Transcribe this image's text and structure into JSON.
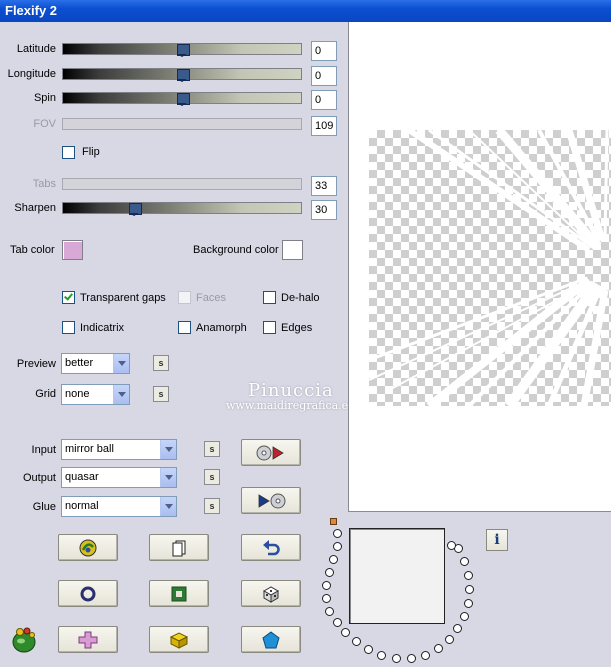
{
  "window": {
    "title": "Flexify 2"
  },
  "sliders": {
    "latitude": {
      "label": "Latitude",
      "value": "0",
      "level": 0.5
    },
    "longitude": {
      "label": "Longitude",
      "value": "0",
      "level": 0.5
    },
    "spin": {
      "label": "Spin",
      "value": "0",
      "level": 0.5
    },
    "fov": {
      "label": "FOV",
      "value": "109",
      "disabled": true
    },
    "tabs": {
      "label": "Tabs",
      "value": "33",
      "disabled": true
    },
    "sharpen": {
      "label": "Sharpen",
      "value": "30",
      "level": 0.3
    }
  },
  "flip": {
    "label": "Flip",
    "checked": false
  },
  "colors": {
    "tab_color_label": "Tab color",
    "tab_color": "#d8a9d6",
    "background_color_label": "Background color",
    "background_color": "#ffffff"
  },
  "options": {
    "transparent_gaps": {
      "label": "Transparent gaps",
      "checked": true
    },
    "faces": {
      "label": "Faces",
      "checked": false,
      "disabled": true
    },
    "de_halo": {
      "label": "De-halo",
      "checked": false
    },
    "indicatrix": {
      "label": "Indicatrix",
      "checked": false
    },
    "anamorph": {
      "label": "Anamorph",
      "checked": false
    },
    "edges": {
      "label": "Edges",
      "checked": false
    }
  },
  "preview": {
    "label": "Preview",
    "value": "better"
  },
  "grid": {
    "label": "Grid",
    "value": "none"
  },
  "input": {
    "label": "Input",
    "value": "mirror ball"
  },
  "output": {
    "label": "Output",
    "value": "quasar"
  },
  "glue": {
    "label": "Glue",
    "value": "normal"
  },
  "small_button_label": "s",
  "watermark": {
    "line1": "Pinuccia",
    "line2": "www.maidiregrafica.eu"
  },
  "info_label": "i",
  "icons": [
    "play-forward-icon",
    "play-reverse-icon",
    "randomize-icon",
    "copy-icon",
    "undo-icon",
    "circle-icon",
    "square-icon",
    "dice-icon",
    "plus-icon",
    "cube-icon",
    "pentagon-icon",
    "app-logo-icon"
  ]
}
